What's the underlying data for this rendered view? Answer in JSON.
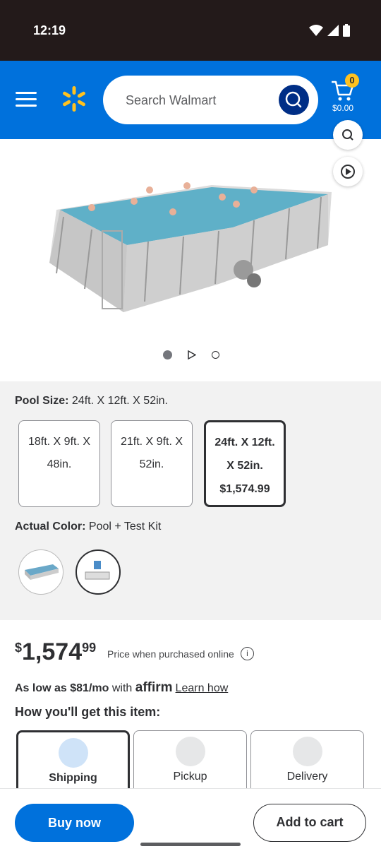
{
  "status_bar": {
    "time": "12:19"
  },
  "header": {
    "search_placeholder": "Search Walmart",
    "cart_count": "0",
    "cart_total": "$0.00",
    "brand_color": "#0071dc",
    "search_button_color": "#002e86",
    "badge_color": "#ffc220"
  },
  "options": {
    "pool_size_label": "Pool Size:",
    "pool_size_value": "24ft. X 12ft. X 52in.",
    "sizes": [
      {
        "line1": "18ft. X 9ft. X",
        "line2": "48in.",
        "price": ""
      },
      {
        "line1": "21ft. X 9ft. X",
        "line2": "52in.",
        "price": ""
      },
      {
        "line1": "24ft. X 12ft.",
        "line2": "X 52in.",
        "price": "$1,574.99"
      }
    ],
    "color_label": "Actual Color:",
    "color_value": "Pool + Test Kit"
  },
  "price": {
    "currency": "$",
    "dollars": "1,574",
    "cents": "99",
    "note": "Price when purchased online",
    "affirm_prefix": "As low as $81/mo",
    "affirm_with": "with",
    "affirm_logo": "affirm",
    "affirm_link": "Learn how"
  },
  "fulfillment": {
    "title": "How you'll get this item:",
    "options": [
      "Shipping",
      "Pickup",
      "Delivery"
    ]
  },
  "actions": {
    "buy_now": "Buy now",
    "add_to_cart": "Add to cart"
  }
}
